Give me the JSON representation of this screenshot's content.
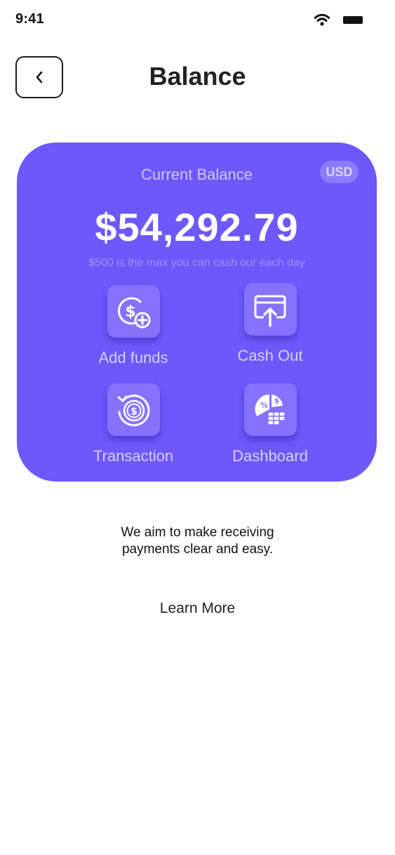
{
  "status_bar": {
    "time": "9:41"
  },
  "header": {
    "title": "Balance"
  },
  "card": {
    "label": "Current Balance",
    "currency": "USD",
    "amount": "$54,292.79",
    "note": "$500 is the max you can cash our each day",
    "color": "#6c58fb"
  },
  "actions": [
    {
      "label": "Add funds",
      "icon": "dollar-add-icon"
    },
    {
      "label": "Cash Out",
      "icon": "cash-out-icon"
    },
    {
      "label": "Transaction",
      "icon": "transaction-history-icon"
    },
    {
      "label": "Dashboard",
      "icon": "dashboard-chart-icon"
    }
  ],
  "tagline": "We aim to make receiving payments clear and easy.",
  "learn_more": "Learn More"
}
